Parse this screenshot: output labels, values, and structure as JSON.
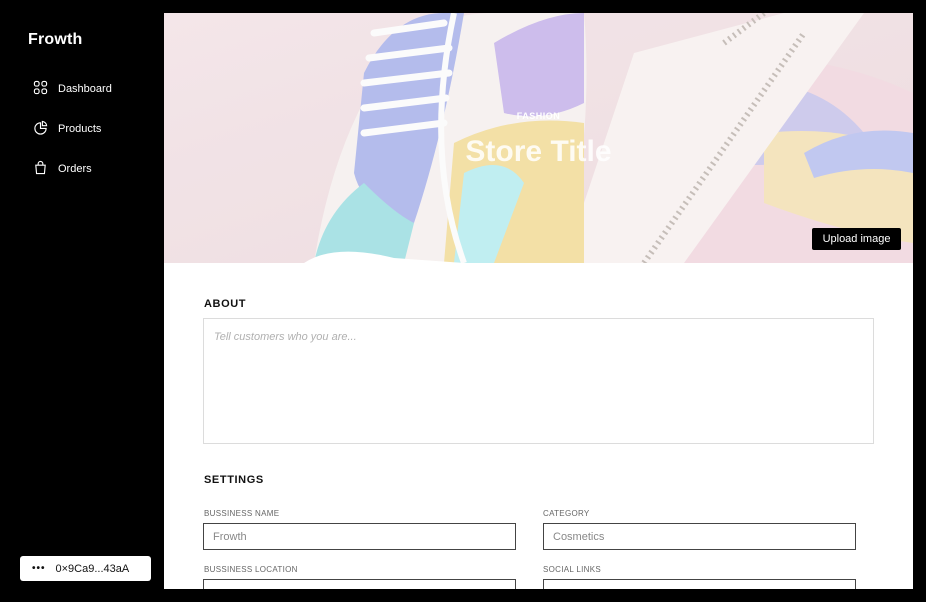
{
  "sidebar": {
    "brand": "Frowth",
    "items": [
      {
        "label": "Dashboard",
        "icon": "grid-icon"
      },
      {
        "label": "Products",
        "icon": "pie-chart-icon"
      },
      {
        "label": "Orders",
        "icon": "shopping-bag-icon"
      }
    ],
    "wallet": {
      "icon": "more-dots-icon",
      "address": "0×9Ca9...43aA"
    }
  },
  "hero": {
    "tag": "FASHION",
    "title": "Store Title",
    "upload_label": "Upload image"
  },
  "about": {
    "title": "ABOUT",
    "placeholder": "Tell customers who you are..."
  },
  "settings": {
    "title": "SETTINGS",
    "business_name": {
      "label": "BUSSINESS NAME",
      "placeholder": "Frowth"
    },
    "category": {
      "label": "CATEGORY",
      "placeholder": "Cosmetics"
    },
    "business_location": {
      "label": "BUSSINESS LOCATION",
      "placeholder": ""
    },
    "social_links": {
      "label": "SOCIAL LINKS",
      "placeholder": ""
    }
  }
}
